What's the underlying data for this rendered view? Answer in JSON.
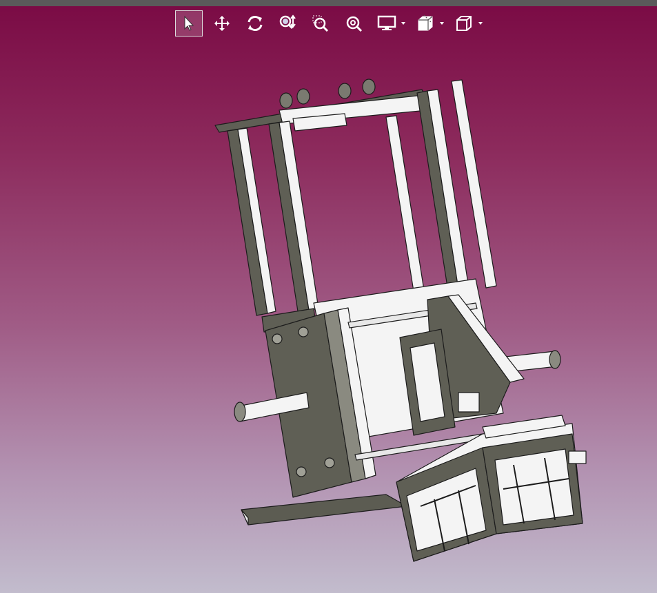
{
  "toolbar": {
    "tools": [
      {
        "name": "select-icon",
        "active": true
      },
      {
        "name": "pan-icon",
        "active": false
      },
      {
        "name": "rotate-icon",
        "active": false
      },
      {
        "name": "zoom-interactive-icon",
        "active": false
      },
      {
        "name": "zoom-window-icon",
        "active": false
      },
      {
        "name": "zoom-fit-icon",
        "active": false
      },
      {
        "name": "display-mode-icon",
        "dropdown": true
      },
      {
        "name": "section-view-icon",
        "dropdown": true
      },
      {
        "name": "standard-views-icon",
        "dropdown": true
      }
    ]
  },
  "viewport": {
    "background_top": "#7a0a44",
    "background_bottom": "#c2bccd",
    "model": "3d-machine-assembly"
  }
}
